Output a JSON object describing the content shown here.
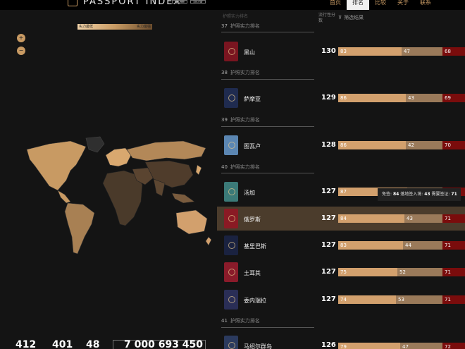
{
  "header": {
    "logo_text": "PASSPORT INDEX",
    "lang_buttons": [
      "繁體",
      "简体"
    ],
    "nav": [
      {
        "label": "首页",
        "active": false
      },
      {
        "label": "排名",
        "active": true
      },
      {
        "label": "比较",
        "active": false
      },
      {
        "label": "关于",
        "active": false
      },
      {
        "label": "联系",
        "active": false
      }
    ]
  },
  "map": {
    "legend_low": "实力最低",
    "legend_high": "实力最强",
    "zoom_in": "+",
    "zoom_out": "−"
  },
  "stats": [
    "412",
    "401",
    "48",
    "7 000 693 450"
  ],
  "list": {
    "header_rank_label": "流行性分数",
    "filter_label": "筛选结果",
    "ghost_group": "护照实力排名",
    "groups": [
      {
        "num": "37",
        "label": "护照实力排名"
      },
      {
        "num": "38",
        "label": "护照实力排名"
      },
      {
        "num": "39",
        "label": "护照实力排名"
      },
      {
        "num": "40",
        "label": "护照实力排名"
      },
      {
        "num": "41",
        "label": "护照实力排名"
      }
    ],
    "rows": [
      {
        "name": "黑山",
        "score": "130",
        "vf": "83",
        "voa": "47",
        "vr": "68",
        "color": "#7a1520"
      },
      {
        "name": "萨摩亚",
        "score": "129",
        "vf": "86",
        "voa": "43",
        "vr": "69",
        "color": "#1f2b4f"
      },
      {
        "name": "图瓦卢",
        "score": "128",
        "vf": "86",
        "voa": "42",
        "vr": "70",
        "color": "#5b86b2"
      },
      {
        "name": "汤加",
        "score": "127",
        "vf": "87",
        "voa": "40",
        "vr": "71",
        "color": "#3b7a78"
      },
      {
        "name": "俄罗斯",
        "score": "127",
        "vf": "84",
        "voa": "43",
        "vr": "71",
        "color": "#8a1a24"
      },
      {
        "name": "基里巴斯",
        "score": "127",
        "vf": "83",
        "voa": "44",
        "vr": "71",
        "color": "#1a2240"
      },
      {
        "name": "土耳其",
        "score": "127",
        "vf": "75",
        "voa": "52",
        "vr": "71",
        "color": "#8a1b2a"
      },
      {
        "name": "委内瑞拉",
        "score": "127",
        "vf": "74",
        "voa": "53",
        "vr": "71",
        "color": "#2a2e56"
      },
      {
        "name": "马绍尔群岛",
        "score": "126",
        "vf": "79",
        "voa": "47",
        "vr": "72",
        "color": "#2b3a5e"
      }
    ]
  },
  "tooltip": {
    "vf_label": "免签",
    "vf_val": "84",
    "voa_label": "落地签入境",
    "voa_val": "43",
    "vr_label": "需要签证",
    "vr_val": "71"
  },
  "colors": {
    "accent": "#c89a63",
    "visa_free": "#d2a06d",
    "visa_on_arrival": "#9a7a5a",
    "visa_required": "#7a0c0c"
  }
}
